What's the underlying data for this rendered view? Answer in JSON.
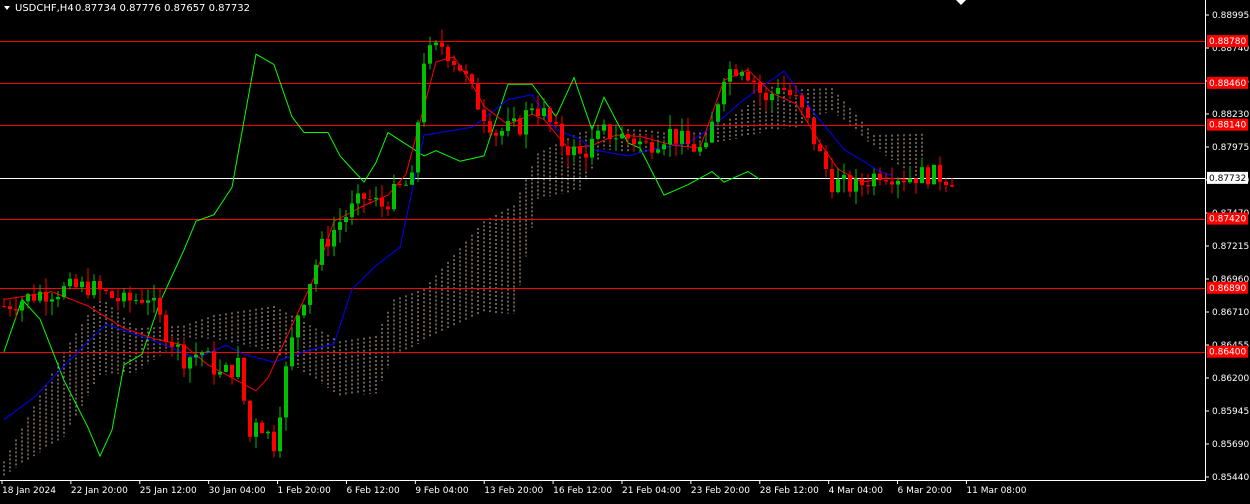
{
  "header": {
    "symbol": "USDCHF,H4",
    "ohlc": "0.87734 0.87776 0.87657 0.87732"
  },
  "colors": {
    "background": "#000000",
    "bull_candle": "#00c000",
    "bear_candle": "#ff0000",
    "tenkan": "#ff0000",
    "kijun": "#0000ff",
    "chikou": "#00ff00",
    "kumo": "#ffdab9",
    "level_line": "#ff0000",
    "current_line": "#ffffff",
    "level_label_bg": "#ff0000",
    "current_label_bg": "#ffffff"
  },
  "chart_data": {
    "type": "candlestick",
    "title": "USDCHF,H4",
    "ylim": [
      0.8544,
      0.8898
    ],
    "y_ticks": [
      "0.88995",
      "0.88740",
      "0.88485",
      "0.88230",
      "0.87975",
      "0.87720",
      "0.87470",
      "0.87215",
      "0.86960",
      "0.86710",
      "0.86455",
      "0.86200",
      "0.85945",
      "0.85690",
      "0.85440"
    ],
    "x_ticks": [
      "18 Jan 2024",
      "22 Jan 20:00",
      "25 Jan 12:00",
      "30 Jan 04:00",
      "1 Feb 20:00",
      "6 Feb 12:00",
      "9 Feb 04:00",
      "13 Feb 20:00",
      "16 Feb 12:00",
      "21 Feb 04:00",
      "23 Feb 20:00",
      "28 Feb 12:00",
      "4 Mar 04:00",
      "6 Mar 20:00",
      "11 Mar 08:00"
    ],
    "horizontal_levels": [
      "0.88780",
      "0.88460",
      "0.88140",
      "0.87420",
      "0.86890",
      "0.86400"
    ],
    "current_price": "0.87732",
    "price_path": [
      [
        0,
        0.8675
      ],
      [
        6,
        0.8685
      ],
      [
        14,
        0.869
      ],
      [
        20,
        0.8678
      ],
      [
        24,
        0.8683
      ],
      [
        27,
        0.8655
      ],
      [
        30,
        0.8635
      ],
      [
        33,
        0.864
      ],
      [
        36,
        0.8622
      ],
      [
        39,
        0.863
      ],
      [
        41,
        0.8575
      ],
      [
        42,
        0.859
      ],
      [
        45,
        0.857
      ],
      [
        47,
        0.8625
      ],
      [
        49,
        0.867
      ],
      [
        53,
        0.872
      ],
      [
        56,
        0.874
      ],
      [
        60,
        0.8758
      ],
      [
        63,
        0.8752
      ],
      [
        66,
        0.8765
      ],
      [
        68,
        0.877
      ],
      [
        70,
        0.8865
      ],
      [
        73,
        0.8875
      ],
      [
        76,
        0.8858
      ],
      [
        79,
        0.883
      ],
      [
        82,
        0.8808
      ],
      [
        86,
        0.8813
      ],
      [
        88,
        0.883
      ],
      [
        90,
        0.8822
      ],
      [
        93,
        0.88
      ],
      [
        96,
        0.879
      ],
      [
        100,
        0.8808
      ],
      [
        104,
        0.8804
      ],
      [
        107,
        0.8798
      ],
      [
        111,
        0.8808
      ],
      [
        114,
        0.8798
      ],
      [
        117,
        0.8793
      ],
      [
        120,
        0.8854
      ],
      [
        123,
        0.886
      ],
      [
        125,
        0.8848
      ],
      [
        127,
        0.883
      ],
      [
        129,
        0.8846
      ],
      [
        132,
        0.8832
      ],
      [
        134,
        0.8815
      ],
      [
        136,
        0.879
      ],
      [
        138,
        0.877
      ],
      [
        142,
        0.8766
      ],
      [
        146,
        0.8778
      ],
      [
        150,
        0.8774
      ],
      [
        154,
        0.8776
      ],
      [
        158,
        0.8773
      ]
    ],
    "kumo": [
      [
        0,
        0.8545,
        0.8556
      ],
      [
        10,
        0.8575,
        0.864
      ],
      [
        16,
        0.8622,
        0.8682
      ],
      [
        22,
        0.8624,
        0.8658
      ],
      [
        30,
        0.865,
        0.866
      ],
      [
        35,
        0.865,
        0.8668
      ],
      [
        45,
        0.864,
        0.8675
      ],
      [
        56,
        0.8606,
        0.8648
      ],
      [
        62,
        0.8608,
        0.8652
      ],
      [
        65,
        0.8637,
        0.868
      ],
      [
        70,
        0.8648,
        0.8688
      ],
      [
        80,
        0.867,
        0.874
      ],
      [
        85,
        0.8669,
        0.8752
      ],
      [
        89,
        0.8757,
        0.8792
      ],
      [
        96,
        0.8764,
        0.8808
      ],
      [
        100,
        0.8795,
        0.8811
      ],
      [
        107,
        0.8792,
        0.881
      ],
      [
        110,
        0.879,
        0.8808
      ],
      [
        118,
        0.88,
        0.8808
      ],
      [
        122,
        0.8803,
        0.8822
      ],
      [
        128,
        0.881,
        0.8843
      ],
      [
        132,
        0.8812,
        0.8841
      ],
      [
        138,
        0.8825,
        0.8842
      ],
      [
        145,
        0.8797,
        0.8806
      ],
      [
        153,
        0.877,
        0.8807
      ]
    ],
    "kijun": [
      [
        0,
        0.8588
      ],
      [
        5,
        0.8605
      ],
      [
        10,
        0.8629
      ],
      [
        17,
        0.8661
      ],
      [
        24,
        0.865
      ],
      [
        28,
        0.8643
      ],
      [
        32,
        0.8635
      ],
      [
        37,
        0.8645
      ],
      [
        40,
        0.8638
      ],
      [
        45,
        0.8632
      ],
      [
        50,
        0.864
      ],
      [
        55,
        0.8646
      ],
      [
        58,
        0.8688
      ],
      [
        62,
        0.8706
      ],
      [
        66,
        0.872
      ],
      [
        70,
        0.8806
      ],
      [
        78,
        0.8812
      ],
      [
        84,
        0.8833
      ],
      [
        88,
        0.8837
      ],
      [
        92,
        0.881
      ],
      [
        96,
        0.8803
      ],
      [
        98,
        0.8795
      ],
      [
        104,
        0.879
      ],
      [
        108,
        0.8795
      ],
      [
        114,
        0.88
      ],
      [
        118,
        0.8812
      ],
      [
        123,
        0.8832
      ],
      [
        126,
        0.8842
      ],
      [
        130,
        0.8855
      ],
      [
        135,
        0.8823
      ],
      [
        140,
        0.8795
      ],
      [
        146,
        0.8778
      ],
      [
        148,
        0.8775
      ]
    ],
    "tenkan": [
      [
        0,
        0.868
      ],
      [
        8,
        0.8686
      ],
      [
        14,
        0.8675
      ],
      [
        20,
        0.8658
      ],
      [
        25,
        0.865
      ],
      [
        30,
        0.8645
      ],
      [
        34,
        0.863
      ],
      [
        38,
        0.862
      ],
      [
        42,
        0.861
      ],
      [
        44,
        0.862
      ],
      [
        48,
        0.866
      ],
      [
        52,
        0.87
      ],
      [
        55,
        0.874
      ],
      [
        60,
        0.8752
      ],
      [
        64,
        0.876
      ],
      [
        67,
        0.8776
      ],
      [
        72,
        0.8862
      ],
      [
        75,
        0.8866
      ],
      [
        78,
        0.8845
      ],
      [
        80,
        0.8828
      ],
      [
        84,
        0.8814
      ],
      [
        88,
        0.8822
      ],
      [
        90,
        0.8818
      ],
      [
        94,
        0.8796
      ],
      [
        98,
        0.8798
      ],
      [
        102,
        0.8806
      ],
      [
        106,
        0.8805
      ],
      [
        110,
        0.88
      ],
      [
        112,
        0.8798
      ],
      [
        116,
        0.8796
      ],
      [
        120,
        0.8848
      ],
      [
        124,
        0.8856
      ],
      [
        128,
        0.8838
      ],
      [
        132,
        0.883
      ],
      [
        136,
        0.88
      ],
      [
        139,
        0.878
      ],
      [
        143,
        0.877
      ],
      [
        147,
        0.8773
      ],
      [
        151,
        0.8772
      ]
    ],
    "chikou": [
      [
        0,
        0.864
      ],
      [
        3,
        0.868
      ],
      [
        6,
        0.8665
      ],
      [
        10,
        0.8618
      ],
      [
        14,
        0.8582
      ],
      [
        16,
        0.856
      ],
      [
        18,
        0.858
      ],
      [
        20,
        0.863
      ],
      [
        23,
        0.8638
      ],
      [
        26,
        0.8678
      ],
      [
        30,
        0.8718
      ],
      [
        32,
        0.874
      ],
      [
        35,
        0.8745
      ],
      [
        38,
        0.8766
      ],
      [
        42,
        0.8868
      ],
      [
        45,
        0.886
      ],
      [
        48,
        0.882
      ],
      [
        50,
        0.8808
      ],
      [
        54,
        0.8808
      ],
      [
        56,
        0.879
      ],
      [
        60,
        0.877
      ],
      [
        62,
        0.8785
      ],
      [
        64,
        0.8808
      ],
      [
        66,
        0.8802
      ],
      [
        70,
        0.879
      ],
      [
        72,
        0.8794
      ],
      [
        76,
        0.8786
      ],
      [
        80,
        0.879
      ],
      [
        84,
        0.8845
      ],
      [
        88,
        0.8845
      ],
      [
        92,
        0.882
      ],
      [
        95,
        0.885
      ],
      [
        98,
        0.881
      ],
      [
        100,
        0.8835
      ],
      [
        104,
        0.88
      ],
      [
        106,
        0.8796
      ],
      [
        110,
        0.876
      ],
      [
        114,
        0.8768
      ],
      [
        118,
        0.8778
      ],
      [
        120,
        0.877
      ],
      [
        124,
        0.8778
      ],
      [
        126,
        0.8772
      ]
    ]
  }
}
